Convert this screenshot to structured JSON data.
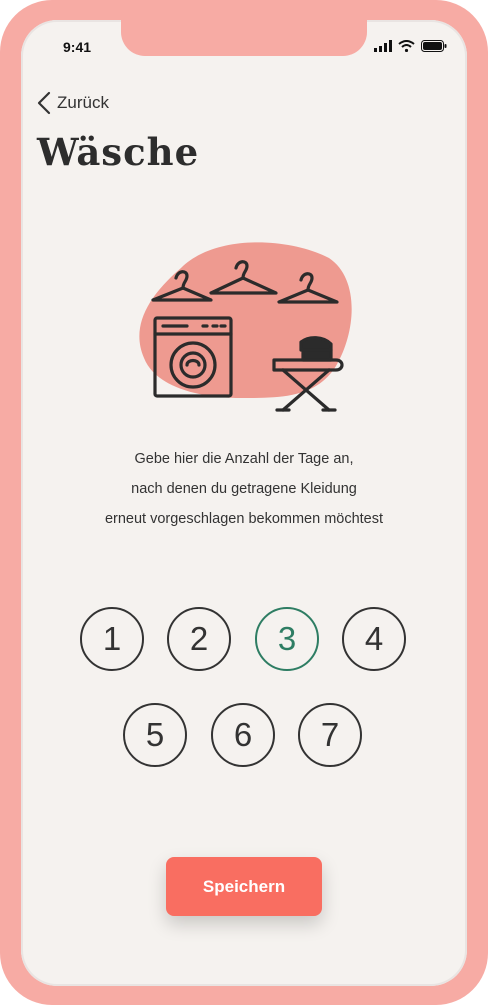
{
  "status_bar": {
    "time": "9:41"
  },
  "nav": {
    "back_label": "Zurück"
  },
  "page": {
    "title": "Wäsche"
  },
  "description": {
    "lines": [
      "Gebe hier die Anzahl der Tage an,",
      "nach denen du getragene Kleidung",
      "erneut vorgeschlagen bekommen möchtest"
    ]
  },
  "day_options": [
    "1",
    "2",
    "3",
    "4",
    "5",
    "6",
    "7"
  ],
  "selected_day": "3",
  "save_label": "Speichern",
  "colors": {
    "accent": "#f96e61",
    "selected": "#2e7d63",
    "frame": "#f7aba4",
    "blob": "#ee9a90"
  },
  "icons": [
    "chevron-left-icon",
    "signal-icon",
    "wifi-icon",
    "battery-icon",
    "laundry-illustration"
  ]
}
